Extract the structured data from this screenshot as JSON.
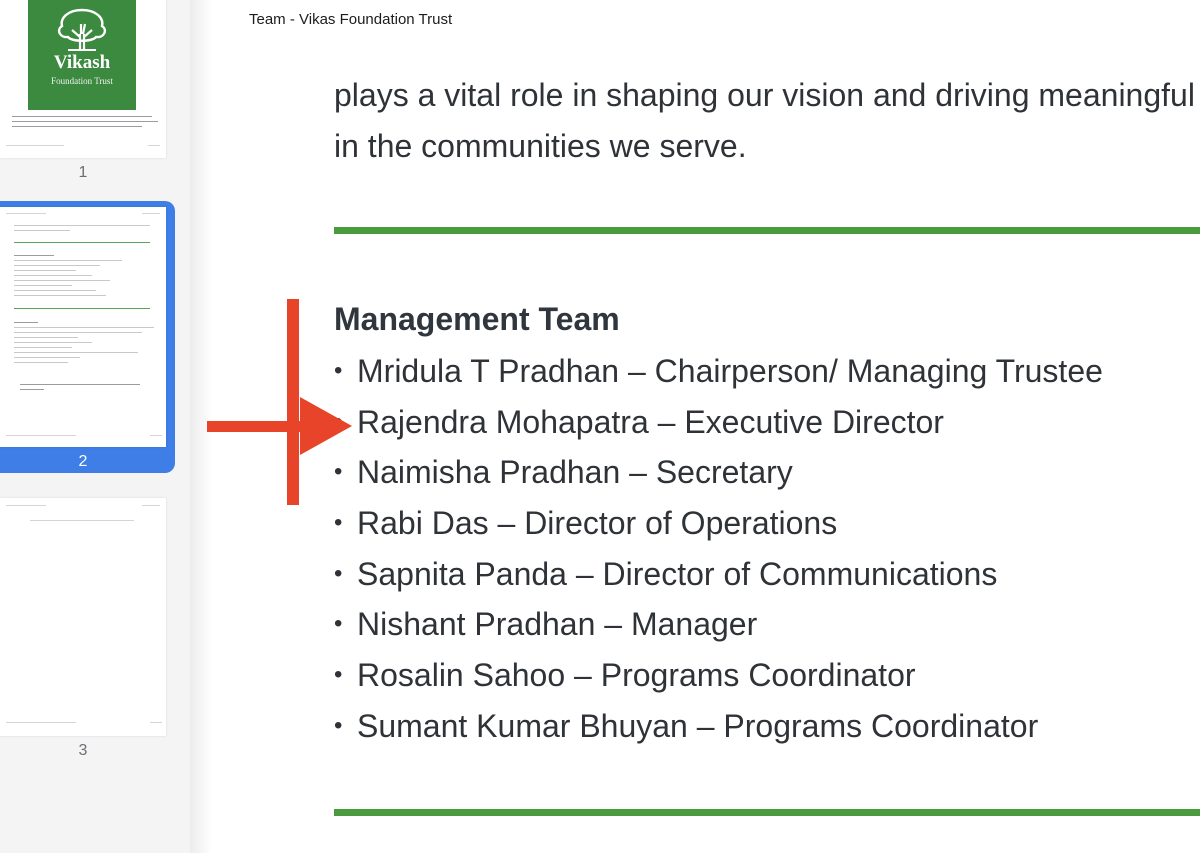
{
  "document": {
    "header_title": "Team - Vikas Foundation Trust",
    "intro_lines": [
      "plays a vital role in shaping our vision and driving meaningful change",
      "in the communities we serve."
    ],
    "section_title": "Management Team",
    "team_members": [
      "Mridula T Pradhan – Chairperson/ Managing Trustee",
      "Rajendra Mohapatra – Executive Director",
      "Naimisha Pradhan – Secretary",
      "Rabi Das – Director of Operations",
      "Sapnita Panda – Director of Communications",
      "Nishant Pradhan – Manager",
      "Rosalin Sahoo – Programs Coordinator",
      "Sumant Kumar Bhuyan – Programs Coordinator"
    ],
    "bullet_char": "•"
  },
  "sidebar": {
    "logo_name": "Vikash",
    "logo_subtitle": "Foundation Trust",
    "pages": [
      {
        "number": "1",
        "selected": false
      },
      {
        "number": "2",
        "selected": true
      },
      {
        "number": "3",
        "selected": false
      }
    ]
  },
  "colors": {
    "accent_green": "#4a9a3e",
    "logo_green": "#3c8a3f",
    "selection_blue": "#3e7ee6",
    "annotation_red": "#e8442a"
  }
}
